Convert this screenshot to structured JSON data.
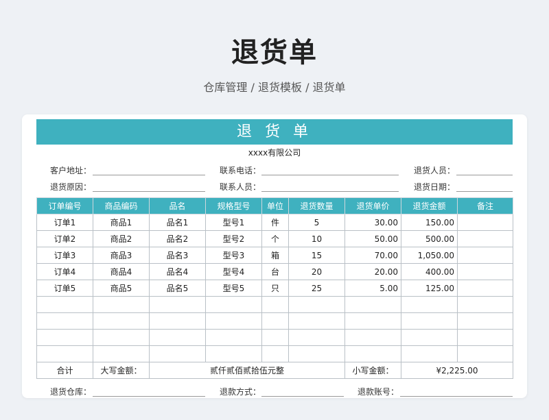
{
  "page": {
    "title": "退货单",
    "breadcrumb": "仓库管理 / 退货模板 / 退货单"
  },
  "form": {
    "banner_title": "退 货 单",
    "company": "xxxx有限公司",
    "fields": {
      "customer_address": "客户地址：",
      "contact_phone": "联系电话：",
      "return_person": "退货人员：",
      "return_reason": "退货原因：",
      "contact_person": "联系人员：",
      "return_date": "退货日期："
    },
    "headers": [
      "订单编号",
      "商品编码",
      "品名",
      "规格型号",
      "单位",
      "退货数量",
      "退货单价",
      "退货金额",
      "备注"
    ],
    "rows": [
      [
        "订单1",
        "商品1",
        "品名1",
        "型号1",
        "件",
        "5",
        "30.00",
        "150.00",
        ""
      ],
      [
        "订单2",
        "商品2",
        "品名2",
        "型号2",
        "个",
        "10",
        "50.00",
        "500.00",
        ""
      ],
      [
        "订单3",
        "商品3",
        "品名3",
        "型号3",
        "箱",
        "15",
        "70.00",
        "1,050.00",
        ""
      ],
      [
        "订单4",
        "商品4",
        "品名4",
        "型号4",
        "台",
        "20",
        "20.00",
        "400.00",
        ""
      ],
      [
        "订单5",
        "商品5",
        "品名5",
        "型号5",
        "只",
        "25",
        "5.00",
        "125.00",
        ""
      ],
      [
        "",
        "",
        "",
        "",
        "",
        "",
        "",
        "",
        ""
      ],
      [
        "",
        "",
        "",
        "",
        "",
        "",
        "",
        "",
        ""
      ],
      [
        "",
        "",
        "",
        "",
        "",
        "",
        "",
        "",
        ""
      ],
      [
        "",
        "",
        "",
        "",
        "",
        "",
        "",
        "",
        ""
      ]
    ],
    "total": {
      "label": "合计",
      "caps_label": "大写金额：",
      "caps_value": "贰仟贰佰贰拾伍元整",
      "small_label": "小写金额：",
      "small_value": "¥2,225.00"
    },
    "footer": {
      "warehouse": "退货仓库：",
      "refund_method": "退款方式：",
      "refund_account": "退款账号："
    }
  },
  "colors": {
    "accent": "#3fb1bf",
    "background": "#eef1f5"
  }
}
